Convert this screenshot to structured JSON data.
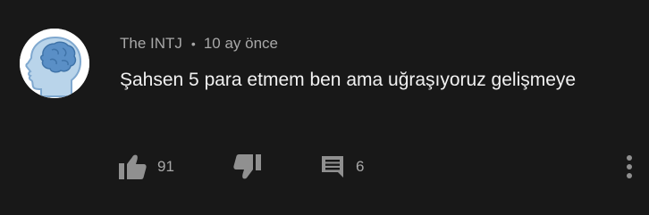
{
  "comment": {
    "author": "The INTJ",
    "separator": "•",
    "timestamp": "10 ay önce",
    "text": "Şahsen 5 para etmem ben ama uğraşıyoruz gelişmeye",
    "avatar_icon": "head-brain-icon",
    "avatar_colors": {
      "background": "#ffffff",
      "head": "#b9d4ea",
      "brain": "#5a8fc6"
    }
  },
  "actions": {
    "like_count": "91",
    "reply_count": "6",
    "like_icon": "thumbs-up-icon",
    "dislike_icon": "thumbs-down-icon",
    "reply_icon": "comment-icon",
    "more_icon": "more-vertical-icon"
  },
  "colors": {
    "background": "#181818",
    "primary_text": "#f1f1f1",
    "secondary_text": "#a8a8a8",
    "icon": "#909090"
  }
}
